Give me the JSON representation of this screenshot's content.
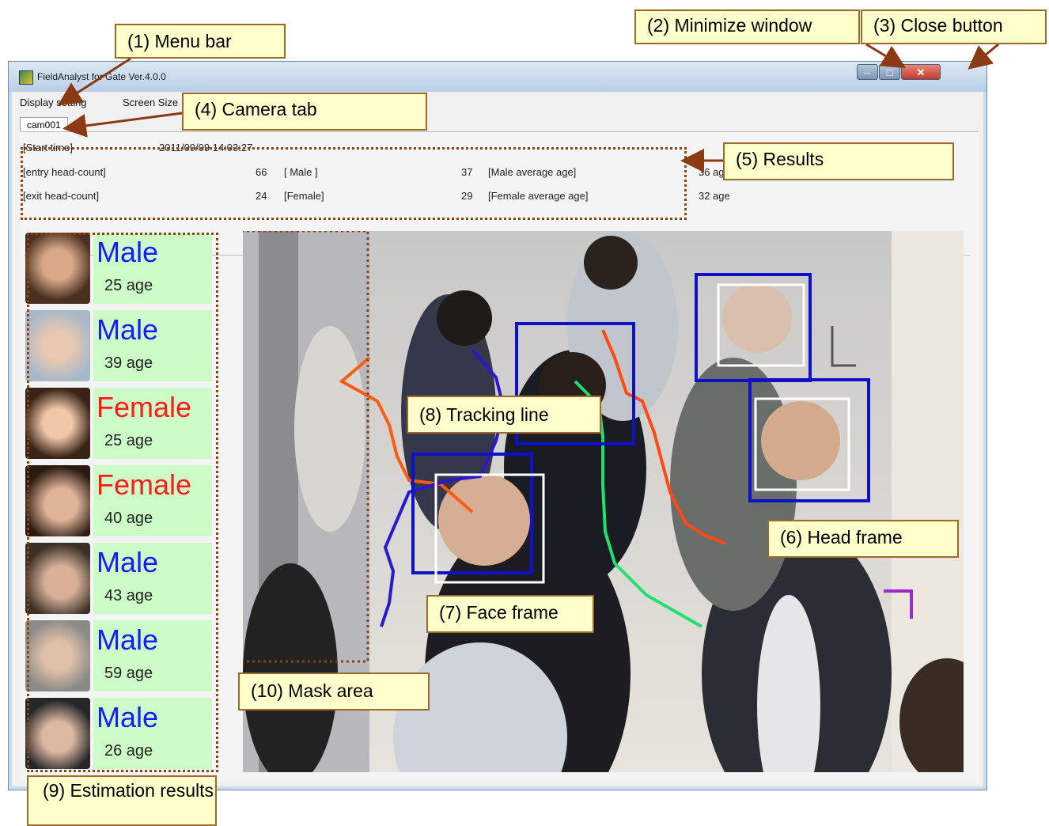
{
  "window": {
    "title": "FieldAnalyst for Gate Ver.4.0.0",
    "minimize_glyph": "–",
    "maximize_glyph": "□",
    "close_glyph": "✕"
  },
  "menu": {
    "items": [
      "Display setting",
      "Screen Size"
    ]
  },
  "tabs": [
    "cam001"
  ],
  "results": {
    "start_label": "[Start time]",
    "start_value": "2011/09/09 14:03:27",
    "entry_label": "[entry head-count]",
    "entry_value": "66",
    "male_label": "[ Male ]",
    "male_value": "37",
    "male_avg_label": "[Male average age]",
    "male_avg_value": "36 age",
    "exit_label": "[exit  head-count]",
    "exit_value": "24",
    "female_label": "[Female]",
    "female_value": "29",
    "female_avg_label": "[Female average age]",
    "female_avg_value": "32 age"
  },
  "estimations": [
    {
      "gender": "Male",
      "age": "25 age"
    },
    {
      "gender": "Male",
      "age": "39 age"
    },
    {
      "gender": "Female",
      "age": "25 age"
    },
    {
      "gender": "Female",
      "age": "40 age"
    },
    {
      "gender": "Male",
      "age": "43 age"
    },
    {
      "gender": "Male",
      "age": "59 age"
    },
    {
      "gender": "Male",
      "age": "26 age"
    }
  ],
  "colors": {
    "male": "#1a1aff",
    "female": "#ff1a1a",
    "head_frame": "#1010c8",
    "face_frame": "#ffffff",
    "callout_border": "#9b6a2a",
    "callout_bg": "#ffffcc",
    "dotted_outline": "#8b4513"
  },
  "callouts": {
    "menu_bar": "(1) Menu bar",
    "minimize": "(2) Minimize window",
    "close": "(3) Close button",
    "camera_tab": "(4) Camera tab",
    "results": "(5) Results",
    "head_frame": "(6) Head frame",
    "face_frame": "(7) Face frame",
    "tracking_line": "(8) Tracking line",
    "estimation_results": "(9) Estimation results",
    "mask_area": "(10) Mask area"
  }
}
